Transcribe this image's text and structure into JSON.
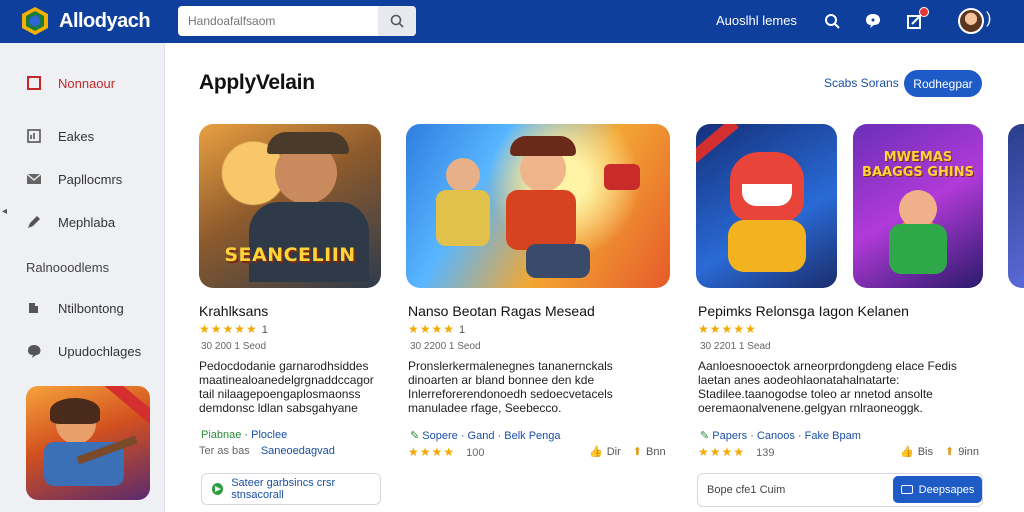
{
  "app": {
    "name": "Allodyach",
    "search_placeholder": "Handoafalfsaom",
    "top_link": "Auoslhl lemes"
  },
  "colors": {
    "topbar": "#0e3f9c",
    "accent": "#1e5bc6",
    "star": "#f2a900",
    "active_sidebar": "#c62828"
  },
  "sidebar": {
    "items": [
      {
        "label": "Nonnaour",
        "icon": "square-icon"
      },
      {
        "label": "Eakes",
        "icon": "chart-icon"
      },
      {
        "label": "Papllocmrs",
        "icon": "mail-icon"
      },
      {
        "label": "Mephlaba",
        "icon": "edit-icon"
      }
    ],
    "section_label": "Ralnooodlems",
    "items2": [
      {
        "label": "Ntilbontong",
        "icon": "puzzle-icon"
      },
      {
        "label": "Upudochlages",
        "icon": "chat-icon"
      }
    ]
  },
  "main": {
    "title": "ApplyVelain",
    "see_link": "Scabs Sorans",
    "primary_button": "Rodhegpar"
  },
  "cards": [
    {
      "image_caption": "SEANCELIIN",
      "title": "Krahlksans",
      "stars": "★★★★★",
      "rating_num": "1",
      "meta": "30   200 1 Seod",
      "desc": [
        "Pedocdodanie garnarodhsiddes",
        "maatinealoanedelgrgnaddccagor",
        "tail nilaagepoengaplosmaonss",
        "demdonsc ldlan sabsgahyane"
      ],
      "tag1": "Piabnae",
      "tag2": "Ploclee",
      "stat": "Ter as bas",
      "stat_link": "Saneoedagvad",
      "button": "Sateer garbsincs crsr stnsacorall"
    },
    {
      "image_caption": "",
      "title": "Nanso Beotan Ragas Mesead",
      "stars": "★★★★",
      "rating_num": "1",
      "meta": "30   2200 1 Seod",
      "desc": [
        "Pronslerkermalenegnes tananernckals",
        "dinoarten ar bland bonnee den kde",
        "Inlerreforerendonoedh sedoecvetacels",
        "manuladee rfage, Seebecco."
      ],
      "tag1": "Sopere",
      "tag2": "Gand",
      "tag3": "Belk Penga",
      "stars2": "★★★★",
      "stat_num": "100",
      "stat_a": "Dir",
      "stat_b": "Bnn"
    },
    {
      "image_caption": "MWEMAS\nBAAGGS GHINS",
      "title": "Pepimks Relonsga Iagon Kelanen",
      "stars": "★★★★★",
      "rating_num": "",
      "meta": "30   2201 1 Sead",
      "desc": [
        "Aanloesnooectok arneorprdongdeng elace Fedis",
        "laetan anes aodeohlaonatahalnatarte:",
        "Stadilee.taanogodse toleo ar nnetod ansolte",
        "oeremaonalvenene.gelgyan rnlraoneoggk."
      ],
      "tag1": "Papers",
      "tag2": "Canoos",
      "tag3": "Fake Bpam",
      "stars2": "★★★★",
      "stat_num": "139",
      "stat_a": "Bis",
      "stat_b": "9inn",
      "input_value": "Bope cfe1 Cuim",
      "button": "Deepsapes"
    }
  ]
}
